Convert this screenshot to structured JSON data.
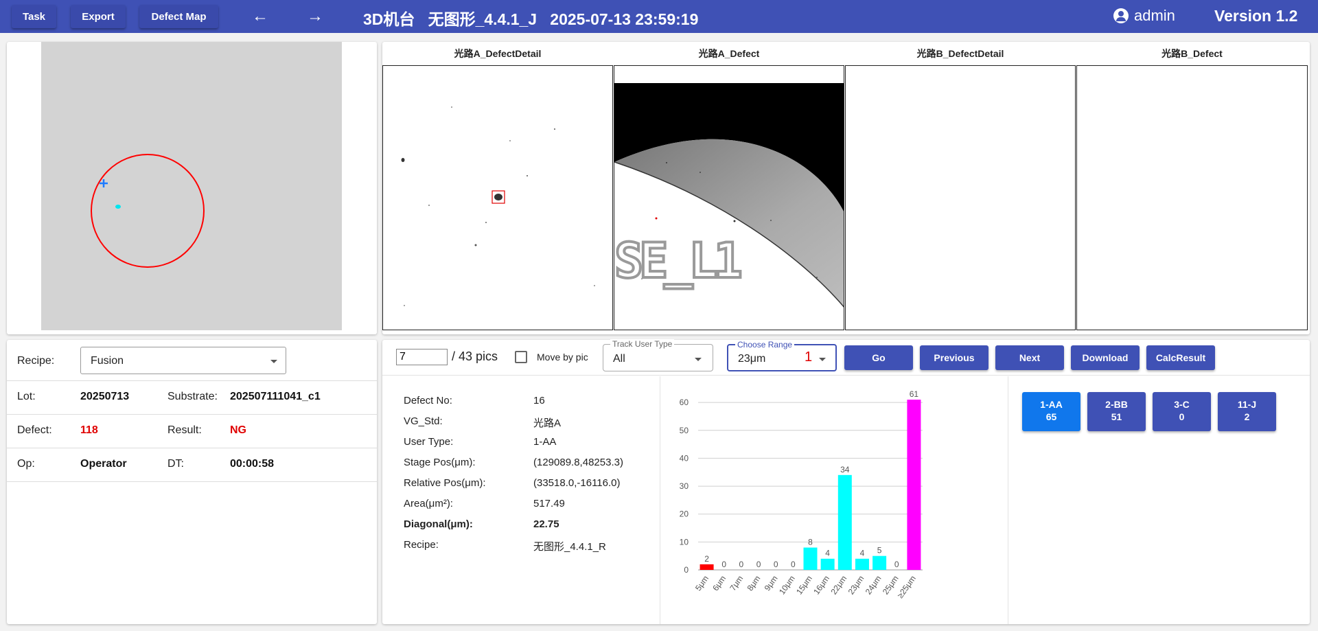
{
  "topbar": {
    "task_label": "Task",
    "export_label": "Export",
    "defect_map_label": "Defect Map",
    "title": "3D机台   无图形_4.4.1_J   2025-07-13 23:59:19",
    "user": "admin",
    "version": "Version 1.2"
  },
  "info": {
    "recipe_label": "Recipe:",
    "recipe_value": "Fusion",
    "lot_label": "Lot:",
    "lot_value": "20250713",
    "substrate_label": "Substrate:",
    "substrate_value": "202507111041_c1",
    "defect_label": "Defect:",
    "defect_value": "118",
    "result_label": "Result:",
    "result_value": "NG",
    "op_label": "Op:",
    "op_value": "Operator",
    "dt_label": "DT:",
    "dt_value": "00:00:58"
  },
  "images": [
    {
      "caption": "光路A_DefectDetail"
    },
    {
      "caption": "光路A_Defect",
      "overlay_text": "SE_L1"
    },
    {
      "caption": "光路B_DefectDetail"
    },
    {
      "caption": "光路B_Defect"
    }
  ],
  "controls": {
    "page_value": "7",
    "pics_label": "/ 43 pics",
    "move_by_pic_label": "Move by pic",
    "track_user_type_legend": "Track User Type",
    "track_user_type_value": "All",
    "choose_range_legend": "Choose Range",
    "choose_range_value": "23μm",
    "choose_range_badge": "1",
    "go_label": "Go",
    "previous_label": "Previous",
    "next_label": "Next",
    "download_label": "Download",
    "calc_label": "CalcResult"
  },
  "details": [
    {
      "label": "Defect No:",
      "value": "16",
      "bold": false
    },
    {
      "label": "VG_Std:",
      "value": "光路A",
      "bold": false
    },
    {
      "label": "User Type:",
      "value": "1-AA",
      "bold": false
    },
    {
      "label": "Stage Pos(μm):",
      "value": "(129089.8,48253.3)",
      "bold": false
    },
    {
      "label": "Relative Pos(μm):",
      "value": "(33518.0,-16116.0)",
      "bold": false
    },
    {
      "label": "Area(μm²):",
      "value": "517.49",
      "bold": false
    },
    {
      "label": "Diagonal(μm):",
      "value": "22.75",
      "bold": true
    },
    {
      "label": "Recipe:",
      "value": "无图形_4.4.1_R",
      "bold": false
    }
  ],
  "chart_data": {
    "type": "bar",
    "categories": [
      "5μm",
      "6μm",
      "7μm",
      "8μm",
      "9μm",
      "10μm",
      "15μm",
      "16μm",
      "22μm",
      "23μm",
      "24μm",
      "25μm",
      "≥25μm"
    ],
    "values": [
      2,
      0,
      0,
      0,
      0,
      0,
      8,
      4,
      34,
      4,
      5,
      0,
      61
    ],
    "colors": [
      "#ff0000",
      "#00ffff",
      "#00ffff",
      "#00ffff",
      "#00ffff",
      "#00ffff",
      "#00ffff",
      "#00ffff",
      "#00ffff",
      "#00ffff",
      "#00ffff",
      "#00ffff",
      "#ff00ff"
    ],
    "yticks": [
      0,
      10,
      20,
      30,
      40,
      50,
      60
    ],
    "ylim": [
      0,
      62
    ],
    "grid": true,
    "title": "",
    "xlabel": "",
    "ylabel": ""
  },
  "type_buttons": [
    {
      "name": "1-AA",
      "count": "65",
      "active": true
    },
    {
      "name": "2-BB",
      "count": "51",
      "active": false
    },
    {
      "name": "3-C",
      "count": "0",
      "active": false
    },
    {
      "name": "11-J",
      "count": "2",
      "active": false
    }
  ],
  "colors": {
    "primary": "#3f51b5",
    "active_type": "#1077ec",
    "alert": "#e00000"
  }
}
